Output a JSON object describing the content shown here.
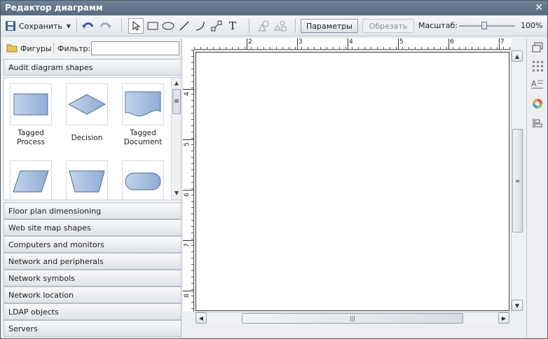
{
  "window": {
    "title": "Редактор диаграмм"
  },
  "toolbar": {
    "save_label": "Сохранить",
    "params_label": "Параметры",
    "crop_label": "Обрезать",
    "zoom_label": "Масштаб:",
    "zoom_value": "100%",
    "zoom_fraction": 0.45,
    "icons": [
      "save-icon",
      "undo-icon",
      "redo-icon",
      "pointer-icon",
      "rectangle-icon",
      "ellipse-icon",
      "line-icon",
      "curve-icon",
      "connector-icon",
      "text-icon",
      "group-icon",
      "ungroup-icon"
    ]
  },
  "left_panel": {
    "shapes_label": "Фигуры",
    "filter_label": "Фильтр:",
    "filter_value": "",
    "active_category": "Audit diagram shapes",
    "shapes": [
      {
        "label": "Tagged Process",
        "icon": "tagged-process-shape"
      },
      {
        "label": "Decision",
        "icon": "decision-shape"
      },
      {
        "label": "Tagged Document",
        "icon": "tagged-document-shape"
      },
      {
        "label": "",
        "icon": "parallelogram-shape"
      },
      {
        "label": "",
        "icon": "trapezoid-shape"
      },
      {
        "label": "",
        "icon": "terminator-shape"
      }
    ],
    "categories": [
      "Floor plan dimensioning",
      "Web site map shapes",
      "Computers and monitors",
      "Network and peripherals",
      "Network symbols",
      "Network location",
      "LDAP objects",
      "Servers"
    ]
  },
  "rulers": {
    "top": [
      "2",
      "3",
      "4",
      "5",
      "6",
      "7"
    ],
    "left": [
      "4",
      "5",
      "6",
      "7",
      "8"
    ]
  },
  "colors": {
    "titlebar": "#5f7389",
    "shape_fill": "#a9c0e0",
    "shape_stroke": "#4a6f9e"
  }
}
